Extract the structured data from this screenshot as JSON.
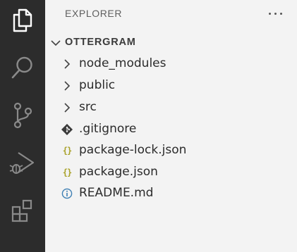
{
  "sidebar": {
    "title": "EXPLORER",
    "more_actions": "···",
    "folder": {
      "name": "OTTERGRAM",
      "expanded": true
    },
    "items": [
      {
        "label": "node_modules",
        "type": "folder",
        "icon": "chevron-right-icon"
      },
      {
        "label": "public",
        "type": "folder",
        "icon": "chevron-right-icon"
      },
      {
        "label": "src",
        "type": "folder",
        "icon": "chevron-right-icon"
      },
      {
        "label": ".gitignore",
        "type": "file",
        "icon": "git-icon"
      },
      {
        "label": "package-lock.json",
        "type": "file",
        "icon": "json-braces-icon",
        "icon_text": "{}"
      },
      {
        "label": "package.json",
        "type": "file",
        "icon": "json-braces-icon",
        "icon_text": "{}"
      },
      {
        "label": "README.md",
        "type": "file",
        "icon": "info-icon"
      }
    ]
  },
  "activity_bar": {
    "items": [
      {
        "name": "explorer",
        "icon": "files-icon",
        "active": true
      },
      {
        "name": "search",
        "icon": "search-icon",
        "active": false
      },
      {
        "name": "source-control",
        "icon": "source-control-icon",
        "active": false
      },
      {
        "name": "run-and-debug",
        "icon": "run-debug-icon",
        "active": false
      },
      {
        "name": "extensions",
        "icon": "extensions-icon",
        "active": false
      }
    ]
  },
  "colors": {
    "activity_bar_bg": "#2c2c2c",
    "active_icon": "#ffffff",
    "inactive_icon": "#8a8a8a",
    "sidebar_bg": "#f3f3f3",
    "json_icon": "#a9a22a",
    "info_icon": "#3e7fb3"
  }
}
